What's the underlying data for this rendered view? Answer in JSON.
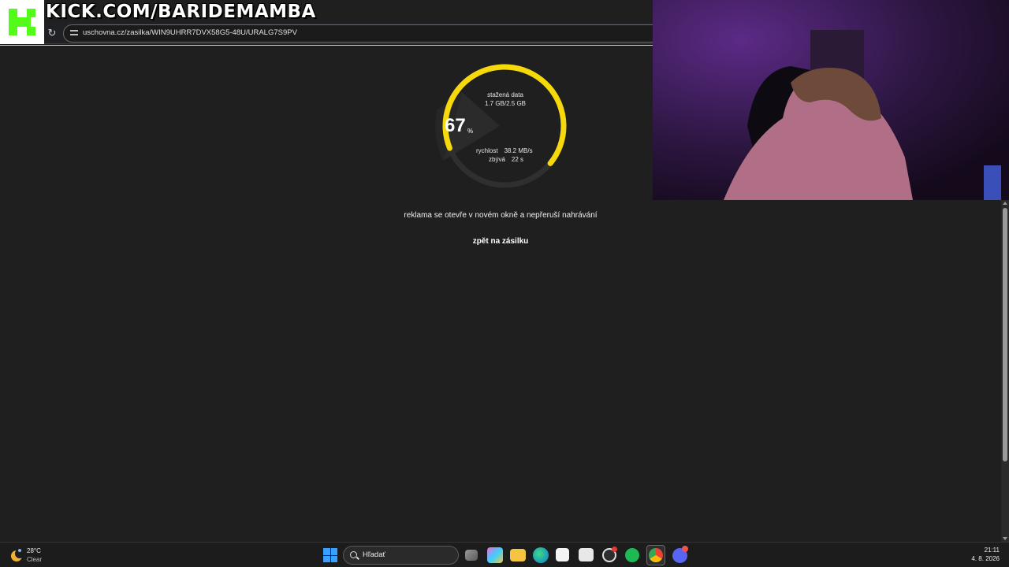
{
  "overlay": {
    "channel": "KICK.COM/BARIDEMAMBA",
    "logo": "kick-logo"
  },
  "browser": {
    "url": "uschovna.cz/zasilka/WIN9UHRR7DVX58G5-48U/URALG7S9PV",
    "reload_icon": "reload-icon",
    "site_info_icon": "tune-icon"
  },
  "progress": {
    "percent": 67,
    "percent_text": "67",
    "percent_unit": "%",
    "downloaded_label": "stažená data",
    "downloaded_value": "1.7 GB/2.5 GB",
    "speed_label": "rychlost",
    "speed_value": "38.2 MB/s",
    "remaining_label": "zbývá",
    "remaining_value": "22 s",
    "accent": "#f5d90a",
    "track": "#2f2f2f"
  },
  "page": {
    "ad_note": "reklama se otevře v novém okně a nepřeruší nahrávání",
    "back_link": "zpět na zásilku"
  },
  "taskbar": {
    "weather_temp": "28°C",
    "weather_cond": "Clear",
    "search_placeholder": "Hľadať",
    "time": "21:11",
    "date": "4. 8. 2026",
    "apps": [
      "task-view-icon",
      "copilot-icon",
      "file-explorer-icon",
      "edge-icon",
      "store-icon",
      "outlook-icon",
      "obs-icon",
      "spotify-icon",
      "chrome-icon",
      "discord-icon"
    ]
  }
}
